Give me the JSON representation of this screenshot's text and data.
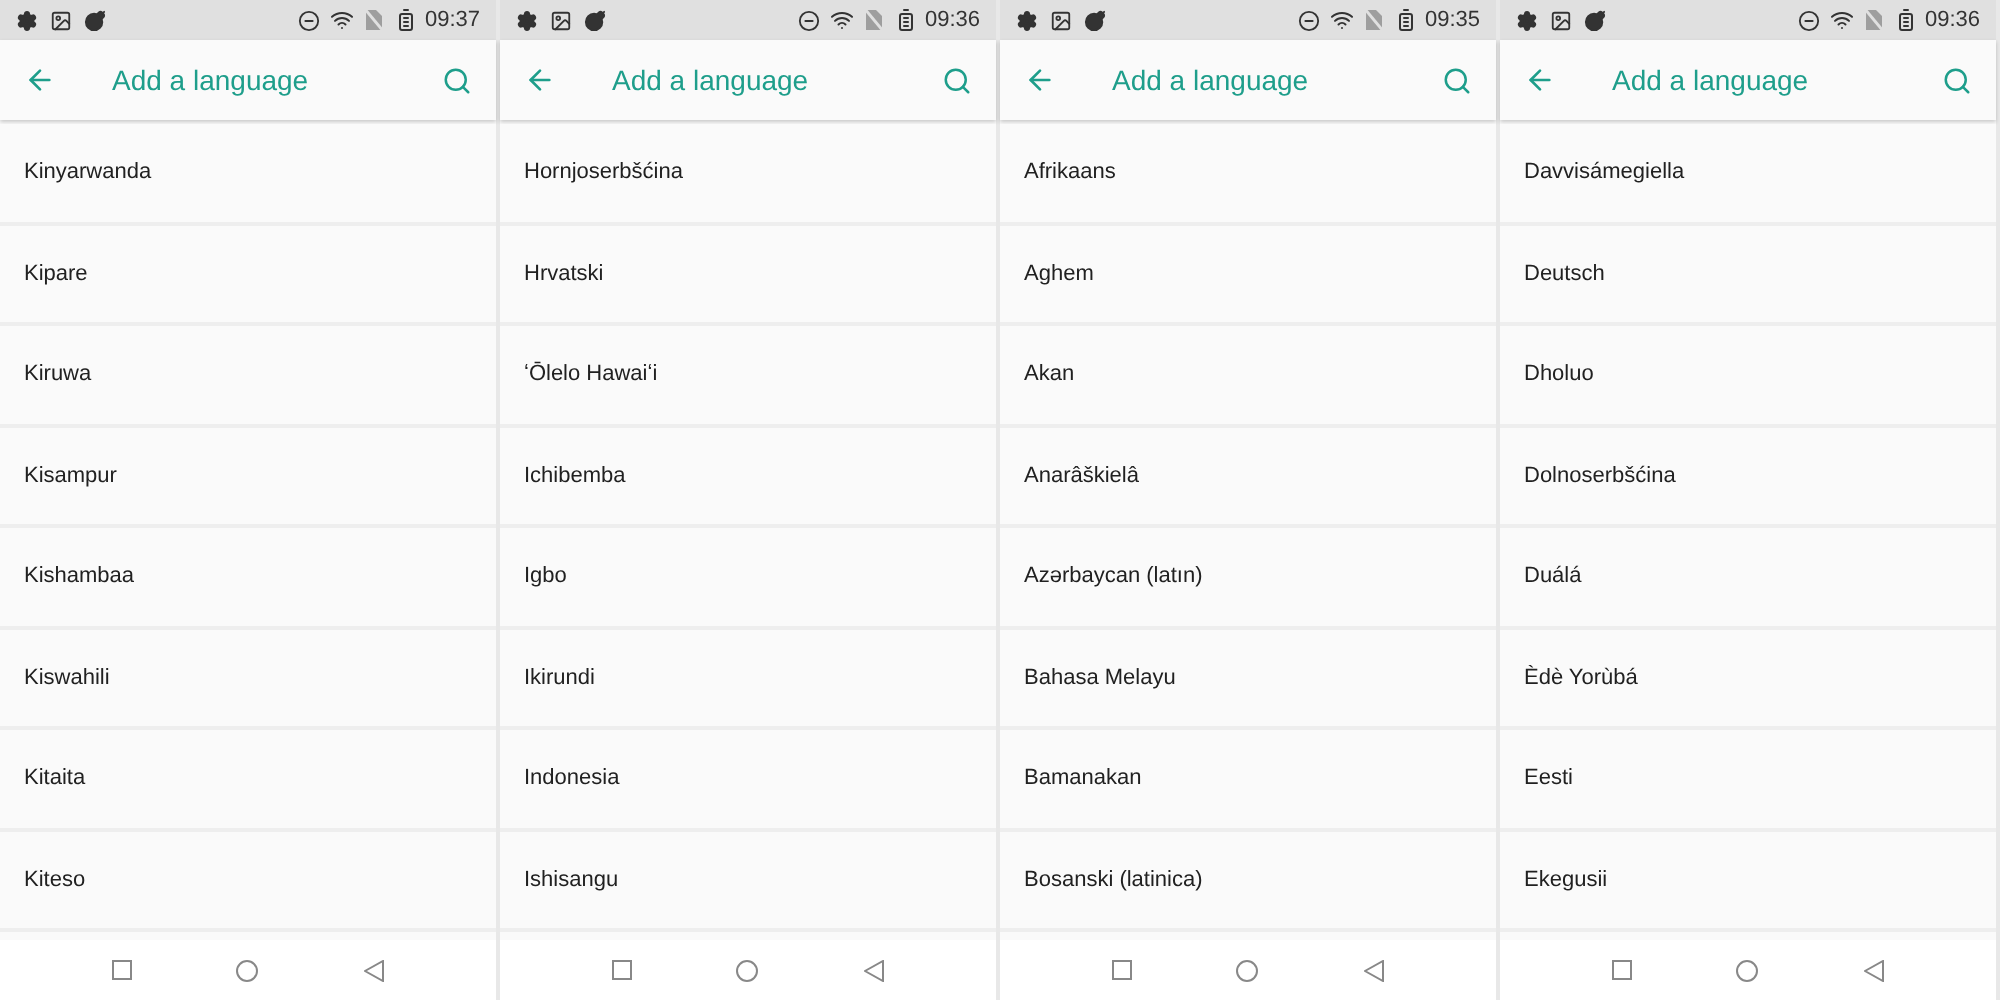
{
  "screens": [
    {
      "status_bar": {
        "time": "09:37"
      },
      "app_bar": {
        "title": "Add a language"
      },
      "languages": [
        "Kinyarwanda",
        "Kipare",
        "Kiruwa",
        "Kisampur",
        "Kishambaa",
        "Kiswahili",
        "Kitaita",
        "Kiteso"
      ]
    },
    {
      "status_bar": {
        "time": "09:36"
      },
      "app_bar": {
        "title": "Add a language"
      },
      "languages": [
        "Hornjoserbšćina",
        "Hrvatski",
        "ʻŌlelo Hawaiʻi",
        "Ichibemba",
        "Igbo",
        "Ikirundi",
        "Indonesia",
        "Ishisangu"
      ]
    },
    {
      "status_bar": {
        "time": "09:35"
      },
      "app_bar": {
        "title": "Add a language"
      },
      "languages": [
        "Afrikaans",
        "Aghem",
        "Akan",
        "Anarâškielâ",
        "Azərbaycan (latın)",
        "Bahasa Melayu",
        "Bamanakan",
        "Bosanski (latinica)"
      ]
    },
    {
      "status_bar": {
        "time": "09:36"
      },
      "app_bar": {
        "title": "Add a language"
      },
      "languages": [
        "Davvisámegiella",
        "Deutsch",
        "Dholuo",
        "Dolnoserbšćina",
        "Duálá",
        "Èdè Yorùbá",
        "Eesti",
        "Ekegusii"
      ]
    }
  ]
}
